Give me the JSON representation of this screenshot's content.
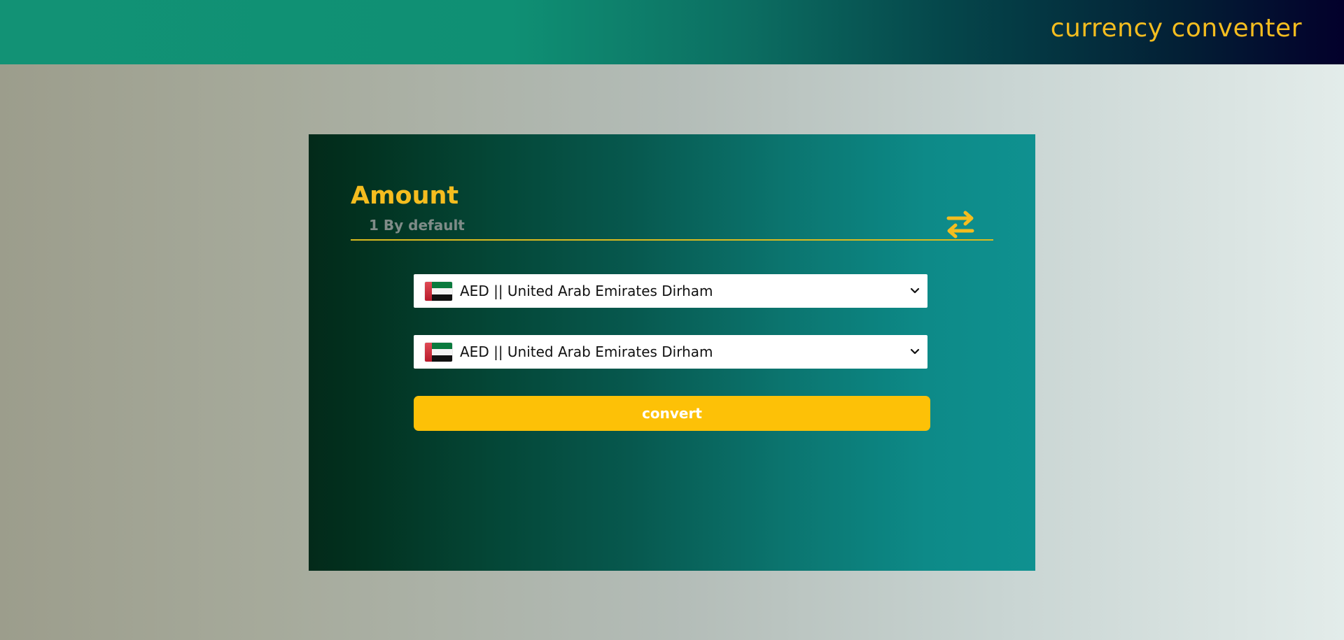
{
  "header": {
    "title": "currency conventer"
  },
  "form": {
    "amount_label": "Amount",
    "amount_placeholder": "1 By default",
    "amount_value": "",
    "swap_icon": "swap-arrows-icon",
    "from_currency": {
      "flag": "ae-flag-icon",
      "label": "AED || United Arab Emirates Dirham"
    },
    "to_currency": {
      "flag": "ae-flag-icon",
      "label": "AED || United Arab Emirates Dirham"
    },
    "convert_label": "convert"
  },
  "colors": {
    "accent": "#fdc107",
    "title_yellow": "#f5bd1f"
  }
}
